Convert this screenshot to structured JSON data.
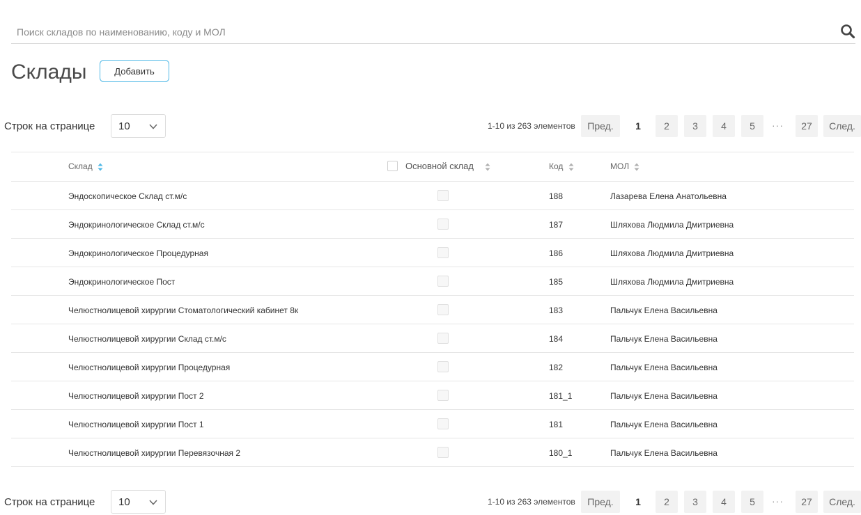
{
  "search": {
    "placeholder": "Поиск складов по наименованию, коду и МОЛ",
    "value": ""
  },
  "page": {
    "title": "Склады",
    "add_button": "Добавить"
  },
  "pagination": {
    "rows_label": "Строк на странице",
    "rows_value": "10",
    "info": "1-10 из 263 элементов",
    "prev": "Пред.",
    "next": "След.",
    "pages": [
      "1",
      "2",
      "3",
      "4",
      "5"
    ],
    "ellipsis": "···",
    "last_page": "27",
    "current_page": "1"
  },
  "table": {
    "columns": {
      "name": "Склад",
      "main": "Основной склад",
      "code": "Код",
      "mol": "МОЛ"
    },
    "rows": [
      {
        "name": "Эндоскопическое Склад ст.м/с",
        "code": "188",
        "mol": "Лазарева Елена Анатольевна"
      },
      {
        "name": "Эндокринологическое Склад ст.м/с",
        "code": "187",
        "mol": "Шляхова Людмила Дмитриевна"
      },
      {
        "name": "Эндокринологическое Процедурная",
        "code": "186",
        "mol": "Шляхова Людмила Дмитриевна"
      },
      {
        "name": "Эндокринологическое Пост",
        "code": "185",
        "mol": "Шляхова Людмила Дмитриевна"
      },
      {
        "name": "Челюстнолицевой хирургии Стоматологический кабинет 8к",
        "code": "183",
        "mol": "Пальчук Елена Васильевна"
      },
      {
        "name": "Челюстнолицевой хирургии Склад ст.м/с",
        "code": "184",
        "mol": "Пальчук Елена Васильевна"
      },
      {
        "name": "Челюстнолицевой хирургии Процедурная",
        "code": "182",
        "mol": "Пальчук Елена Васильевна"
      },
      {
        "name": "Челюстнолицевой хирургии Пост 2",
        "code": "181_1",
        "mol": "Пальчук Елена Васильевна"
      },
      {
        "name": "Челюстнолицевой хирургии Пост 1",
        "code": "181",
        "mol": "Пальчук Елена Васильевна"
      },
      {
        "name": "Челюстнолицевой хирургии Перевязочная 2",
        "code": "180_1",
        "mol": "Пальчук Елена Васильевна"
      }
    ]
  },
  "colors": {
    "accent": "#4fb8e6",
    "sort_active": "#4fb8e6",
    "sort_inactive": "#b0b0b0"
  }
}
